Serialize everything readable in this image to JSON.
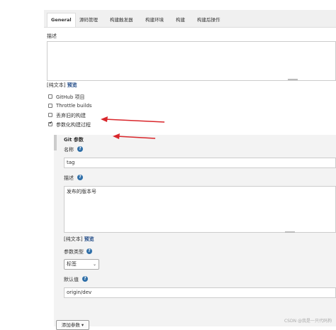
{
  "tabs": [
    {
      "label": "General"
    },
    {
      "label": "源码管理"
    },
    {
      "label": "构建触发器"
    },
    {
      "label": "构建环境"
    },
    {
      "label": "构建"
    },
    {
      "label": "构建后操作"
    }
  ],
  "description": {
    "label": "描述",
    "value": "",
    "plain_text": "[纯文本]",
    "preview": "预览"
  },
  "options": [
    {
      "label": "GitHub 项目",
      "checked": false
    },
    {
      "label": "Throttle builds",
      "checked": false
    },
    {
      "label": "丢弃旧的构建",
      "checked": false
    },
    {
      "label": "参数化构建过程",
      "checked": true
    }
  ],
  "git_param": {
    "title": "Git 参数",
    "name_label": "名称",
    "name_value": "tag",
    "desc_label": "描述",
    "desc_value": "发布的版本号",
    "plain_text": "[纯文本]",
    "preview": "预览",
    "type_label": "参数类型",
    "type_value": "标签",
    "default_label": "默认值",
    "default_value": "origin/dev"
  },
  "add_param_button": "添加参数 ▾",
  "watermark": "CSDN @我是一只代码狗",
  "colors": {
    "accent": "#204a87",
    "help": "#2f6fa8",
    "arrow": "#d9262b"
  }
}
